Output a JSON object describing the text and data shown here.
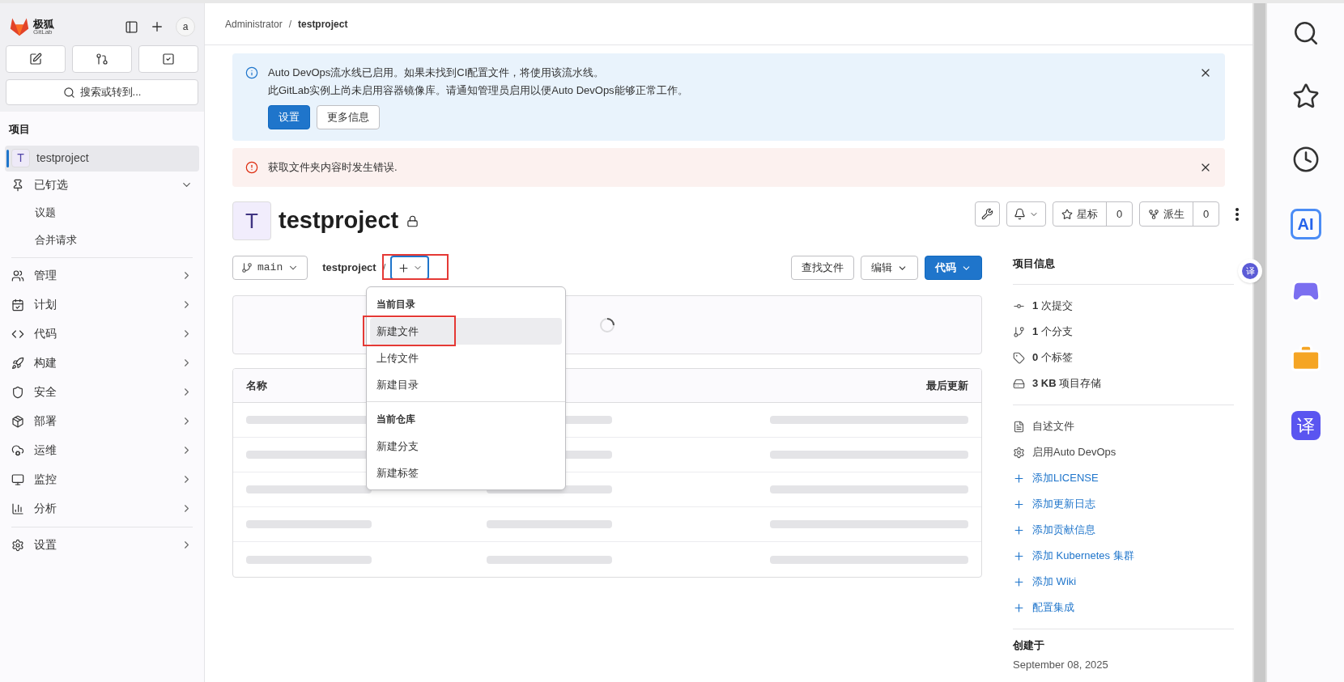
{
  "sidebar": {
    "brand": "极狐",
    "brand_sub": "GitLab",
    "avatar_alt": "a",
    "search": {
      "placeholder": "搜索或转到..."
    },
    "section_title": "项目",
    "project": {
      "initial": "T",
      "name": "testproject",
      "selected": true
    },
    "pinned": {
      "label": "已钉选",
      "expanded": true,
      "children": [
        {
          "label": "议题"
        },
        {
          "label": "合并请求"
        }
      ]
    },
    "menu": [
      {
        "label": "管理"
      },
      {
        "label": "计划"
      },
      {
        "label": "代码"
      },
      {
        "label": "构建"
      },
      {
        "label": "安全"
      },
      {
        "label": "部署"
      },
      {
        "label": "运维"
      },
      {
        "label": "监控"
      },
      {
        "label": "分析"
      }
    ],
    "settings": {
      "label": "设置"
    }
  },
  "breadcrumb": [
    "Administrator",
    "testproject"
  ],
  "breadcrumb_separator": "/",
  "alerts": [
    {
      "kind": "info",
      "lines": [
        "Auto DevOps流水线已启用。如果未找到CI配置文件，将使用该流水线。",
        "此GitLab实例上尚未启用容器镜像库。请通知管理员启用以便Auto DevOps能够正常工作。"
      ],
      "buttons": [
        {
          "label": "设置",
          "primary": true
        },
        {
          "label": "更多信息",
          "primary": false
        }
      ]
    },
    {
      "kind": "error",
      "lines": [
        "获取文件夹内容时发生错误."
      ]
    }
  ],
  "project": {
    "initial": "T",
    "name": "testproject",
    "private": true,
    "star": {
      "label": "星标",
      "count": "0"
    },
    "fork": {
      "label": "派生",
      "count": "0"
    }
  },
  "repo_bar": {
    "branch": "main",
    "path": "testproject",
    "separator": "/",
    "add_highlighted": true,
    "actions": [
      {
        "label": "查找文件",
        "kind": "plain"
      },
      {
        "label": "编辑",
        "kind": "dropdown"
      },
      {
        "label": "代码",
        "kind": "primary"
      }
    ]
  },
  "dropdown": {
    "sections": [
      {
        "title": "当前目录",
        "items": [
          {
            "label": "新建文件",
            "selected": true,
            "highlighted": true
          },
          {
            "label": "上传文件",
            "selected": false,
            "highlighted": false
          },
          {
            "label": "新建目录",
            "selected": false,
            "highlighted": false
          }
        ]
      },
      {
        "title": "当前仓库",
        "items": [
          {
            "label": "新建分支",
            "selected": false,
            "highlighted": false
          },
          {
            "label": "新建标签",
            "selected": false,
            "highlighted": false
          }
        ]
      }
    ]
  },
  "table": {
    "columns": [
      "名称",
      "最后更新"
    ]
  },
  "info_panel": {
    "title": "项目信息",
    "stats": [
      {
        "text": "**1** 次提交"
      },
      {
        "text": "**1** 个分支"
      },
      {
        "text": "**0** 个标签"
      },
      {
        "text": "**3 KB** 项目存储"
      }
    ],
    "links": [
      {
        "label": "自述文件",
        "kind": "plain"
      },
      {
        "label": "启用Auto DevOps",
        "kind": "plain"
      },
      {
        "label": "添加LICENSE",
        "kind": "add"
      },
      {
        "label": "添加更新日志",
        "kind": "add"
      },
      {
        "label": "添加贡献信息",
        "kind": "add"
      },
      {
        "label": "添加 Kubernetes 集群",
        "kind": "add"
      },
      {
        "label": "添加 Wiki",
        "kind": "add"
      },
      {
        "label": "配置集成",
        "kind": "add"
      }
    ],
    "created": {
      "title": "创建于",
      "date": "September 08, 2025"
    }
  },
  "right_rail": {
    "ai_label": "AI",
    "translate_label": "译",
    "float_label": "译"
  }
}
